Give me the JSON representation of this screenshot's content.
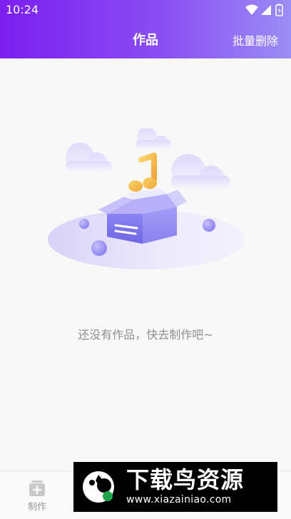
{
  "status_bar": {
    "time": "10:24",
    "icons": [
      "wifi-icon",
      "signal-icon",
      "battery-icon"
    ]
  },
  "header": {
    "title": "作品",
    "action_label": "批量删除"
  },
  "empty_state": {
    "message": "还没有作品，快去制作吧~",
    "illustration": "music-box-illustration"
  },
  "bottom_nav": {
    "items": [
      {
        "label": "制作",
        "icon": "add-square-icon"
      }
    ]
  },
  "watermark": {
    "title": "下载鸟资源",
    "url": "www.xiazainiao.com"
  },
  "colors": {
    "header_start": "#7b1ff0",
    "header_end": "#9a8df4",
    "accent": "#8b7bf0",
    "text_muted": "#8f8f8f"
  }
}
